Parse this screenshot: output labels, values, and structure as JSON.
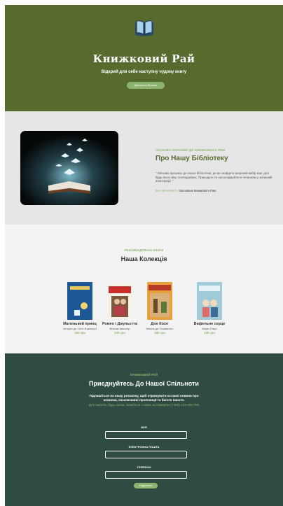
{
  "hero": {
    "title": "Книжковий Рай",
    "subtitle": "Відкрий для себе наступну чудову книгу",
    "cta_label": "Дізнатися більше",
    "icon": "open-book-icon"
  },
  "about": {
    "eyebrow": "ЛАСКАВО ПРОСИМО ДО КНИЖКОВОГО РАЮ",
    "title": "Про Нашу Бібліотеку",
    "quote": "\" Ласкаво просимо до нашої бібліотеки, де ви знайдете широкий вибір книг для будь-якого віку та вподобань. Приходьте та насолоджуйтеся читанням у затишній атмосфері. \"",
    "signature_name": "ВАН ВАНЕНКО",
    "signature_role": "- Засновник Книжкового Раю"
  },
  "collection": {
    "eyebrow": "РЕКОМЕНДОВАНІ КНИГИ",
    "title": "Наша Колекція",
    "books": [
      {
        "title": "Маленький принц",
        "author": "Антуан де Сент-Екзюпері",
        "price": "150 грн"
      },
      {
        "title": "Ромео і Джульєтта",
        "author": "Вільям Шекспір",
        "price": "120 грн"
      },
      {
        "title": "Дон Кіхот",
        "author": "Мігель де Сервантес",
        "price": "180 грн"
      },
      {
        "title": "Вафельне серце",
        "author": "Марія Парр",
        "price": "140 грн"
      }
    ]
  },
  "community": {
    "eyebrow": "КНИЖКОВИЙ РАЙ",
    "title": "Приєднуйтесь До Нашої Спільноти",
    "description": "Підпишіться на нашу розсилку, щоб отримувати останні новини про новинки, ексклюзивні пропозиції та багато іншого.",
    "contact": "Для запитів, будь ласка, звяжіться з нами за номером (+380) 123-456-789",
    "fields": [
      {
        "label": "ІМ'Я",
        "value": ""
      },
      {
        "label": "ЕЛЕКТРОННА ПОШТА",
        "value": ""
      },
      {
        "label": "ТЕЛЕФОН",
        "value": ""
      }
    ],
    "submit_label": "Надіслати"
  },
  "colors": {
    "hero_bg": "#566b2d",
    "accent": "#8bb56e",
    "about_bg": "#e6e6e6",
    "collection_bg": "#f3f3f3",
    "community_bg": "#2f4c43"
  }
}
